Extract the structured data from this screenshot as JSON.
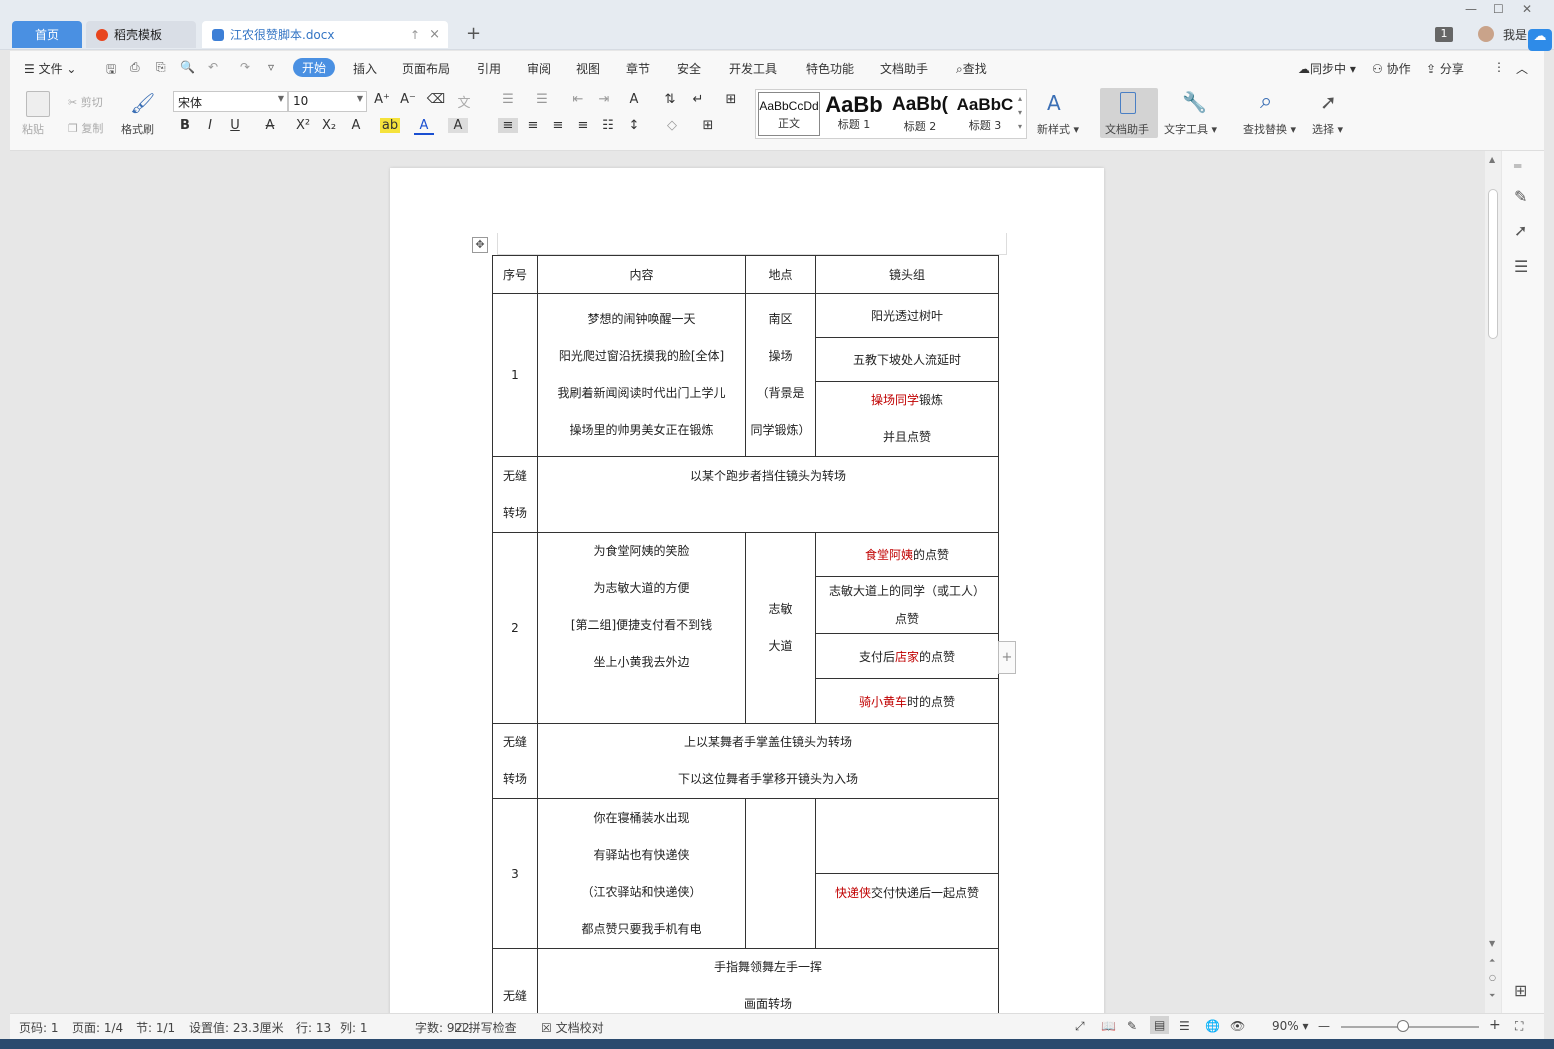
{
  "tabs": {
    "home": "首页",
    "docer": "稻壳模板",
    "doc": "江农很赞脚本.docx",
    "add": "+",
    "pin": "↑",
    "close": "×"
  },
  "window": {
    "badge": "1",
    "user": "我是"
  },
  "menu": {
    "file": "文件",
    "start": "开始",
    "insert": "插入",
    "layout": "页面布局",
    "reference": "引用",
    "review": "审阅",
    "view": "视图",
    "chapter": "章节",
    "security": "安全",
    "devtools": "开发工具",
    "features": "特色功能",
    "assistant": "文档助手",
    "search": "查找",
    "sync": "同步中",
    "collab": "协作",
    "share": "分享"
  },
  "ribbon": {
    "paste": "粘贴",
    "cut": "剪切",
    "copy": "复制",
    "format_painter": "格式刷",
    "font_name": "宋体",
    "font_size": "10",
    "styles": [
      {
        "sample": "AaBbCcDd",
        "name": "正文"
      },
      {
        "sample": "AaBb",
        "name": "标题 1"
      },
      {
        "sample": "AaBb(",
        "name": "标题 2"
      },
      {
        "sample": "AaBbC",
        "name": "标题 3"
      }
    ],
    "new_style": "新样式",
    "doc_assistant": "文档助手",
    "text_tools": "文字工具",
    "find_replace": "查找替换",
    "select": "选择"
  },
  "table": {
    "headers": [
      "序号",
      "内容",
      "地点",
      "镜头组"
    ],
    "row1": {
      "num": "1",
      "content": [
        "梦想的闹钟唤醒一天",
        "阳光爬过窗沿抚摸我的脸[全体]",
        "我刷着新闻阅读时代出门上学儿",
        "操场里的帅男美女正在锻炼"
      ],
      "place": [
        "南区",
        "操场",
        "（背景是",
        "同学锻炼）"
      ],
      "shot1": "阳光透过树叶",
      "shot2": "五教下坡处人流延时",
      "shot3_red": "操场同学",
      "shot3_rest": "锻炼",
      "shot3_line2": "并且点赞"
    },
    "trans1": {
      "label": [
        "无缝",
        "转场"
      ],
      "text": "以某个跑步者挡住镜头为转场"
    },
    "row2": {
      "num": "2",
      "content": [
        "为食堂阿姨的笑脸",
        "为志敏大道的方便",
        "[第二组]便捷支付看不到钱",
        "坐上小黄我去外边"
      ],
      "place": [
        "志敏",
        "大道"
      ],
      "shot1_red": "食堂阿姨",
      "shot1_rest": "的点赞",
      "shot2": [
        "志敏大道上的同学（或工人）",
        "点赞"
      ],
      "shot3_pre": "支付后",
      "shot3_red": "店家",
      "shot3_rest": "的点赞",
      "shot4_red": "骑小黄车",
      "shot4_rest": "时的点赞"
    },
    "trans2": {
      "label": [
        "无缝",
        "转场"
      ],
      "text": [
        "上以某舞者手掌盖住镜头为转场",
        "下以这位舞者手掌移开镜头为入场"
      ]
    },
    "row3": {
      "num": "3",
      "content": [
        "你在寝桶装水出现",
        "有驿站也有快递侠",
        "（江农驿站和快递侠）",
        "都点赞只要我手机有电"
      ],
      "shot2_red": "快递侠",
      "shot2_rest": "交付快递后一起点赞"
    },
    "trans3": {
      "label": [
        "无缝"
      ],
      "text": [
        "手指舞领舞左手一挥",
        "画面转场"
      ]
    }
  },
  "status": {
    "page_code": "页码: 1",
    "pages": "页面: 1/4",
    "section": "节: 1/1",
    "setting": "设置值: 23.3厘米",
    "line": "行: 13",
    "col": "列: 1",
    "words": "字数: 922",
    "spell": "拼写检查",
    "proof": "文档校对",
    "zoom": "90%"
  }
}
